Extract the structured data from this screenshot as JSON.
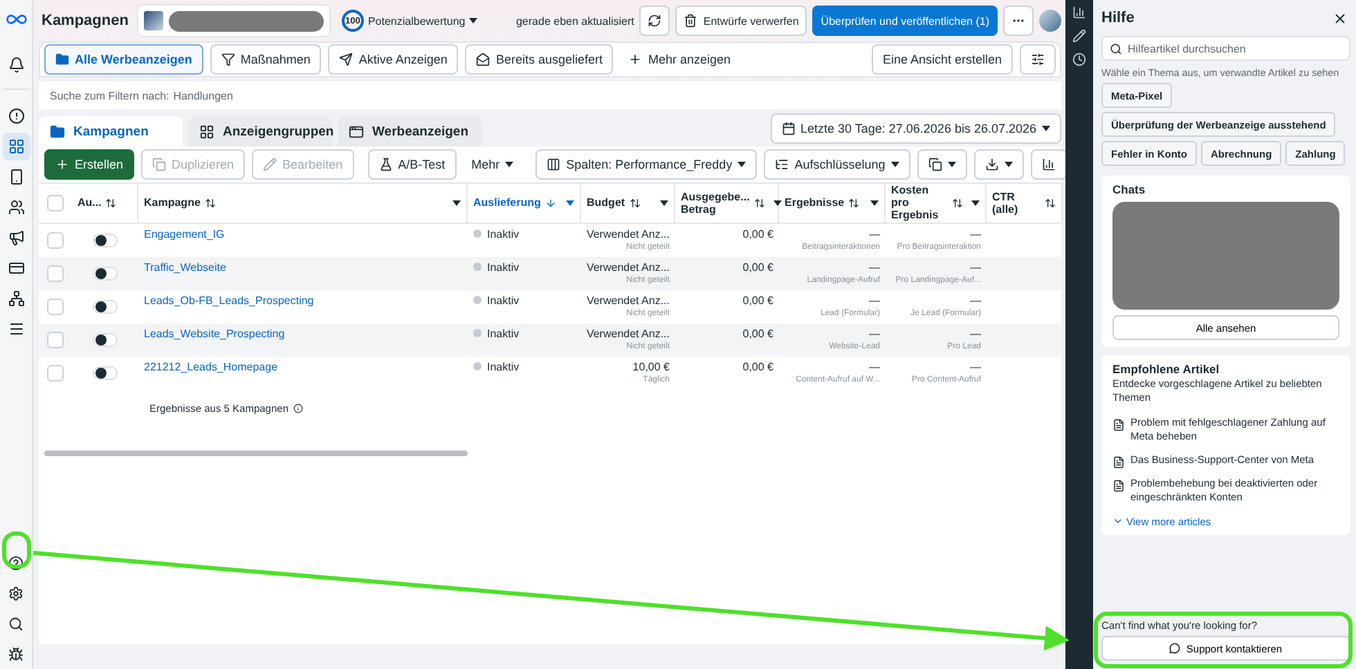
{
  "top_bar": {
    "title": "Kampagnen",
    "score": "100",
    "score_label": "Potenzialbewertung",
    "status": "gerade eben aktualisiert",
    "discard": "Entwürfe verwerfen",
    "publish": "Überprüfen und veröffentlichen (1)"
  },
  "views": [
    {
      "label": "Alle Werbeanzeigen",
      "selected": true
    },
    {
      "label": "Maßnahmen",
      "selected": false
    },
    {
      "label": "Aktive Anzeigen",
      "selected": false
    },
    {
      "label": "Bereits ausgeliefert",
      "selected": false
    }
  ],
  "more_views": "Mehr anzeigen",
  "create_view": "Eine Ansicht erstellen",
  "filter": {
    "label": "Suche zum Filtern nach:",
    "placeholder": "Handlungen"
  },
  "level_tabs": [
    {
      "label": "Kampagnen",
      "selected": true
    },
    {
      "label": "Anzeigengruppen",
      "selected": false
    },
    {
      "label": "Werbeanzeigen",
      "selected": false
    }
  ],
  "date_range": "Letzte 30 Tage: 27.06.2026 bis 26.07.2026",
  "toolbar": {
    "create": "Erstellen",
    "actions": [
      {
        "label": "Duplizieren",
        "disabled": true
      },
      {
        "label": "Bearbeiten",
        "disabled": true
      }
    ],
    "ab_test": "A/B-Test",
    "more": "Mehr",
    "columns": "Spalten: Performance_Freddy",
    "breakdown": "Aufschlüsselung"
  },
  "table": {
    "select_all_checked": false,
    "columns": [
      {
        "label": "Au...",
        "sorted": false,
        "menu": false
      },
      {
        "label": "Kampagne",
        "sorted": false,
        "menu": true
      },
      {
        "label": "Auslieferung",
        "sorted": true,
        "menu": true
      },
      {
        "label": "Budget",
        "sorted": false,
        "menu": true
      },
      {
        "label": "Ausgegebe...\nBetrag",
        "sorted": false,
        "menu": true
      },
      {
        "label": "Ergebnisse",
        "sorted": false,
        "menu": true
      },
      {
        "label": "Kosten pro\nErgebnis",
        "sorted": false,
        "menu": true
      },
      {
        "label": "CTR (alle)",
        "sorted": false,
        "menu": false
      }
    ],
    "rows": [
      {
        "checked": false,
        "on": false,
        "name": "Engagement_IG",
        "delivery": "Inaktiv",
        "budget": "Verwendet Anz...",
        "budget_note": "Nicht geteilt",
        "spent": "0,00 €",
        "results": "—",
        "results_note": "Beitragsinteraktionen",
        "cost": "—",
        "cost_note": "Pro Beitragsinteraktion"
      },
      {
        "checked": false,
        "on": false,
        "name": "Traffic_Webseite",
        "delivery": "Inaktiv",
        "budget": "Verwendet Anz...",
        "budget_note": "Nicht geteilt",
        "spent": "0,00 €",
        "results": "—",
        "results_note": "Landingpage-Aufruf",
        "cost": "—",
        "cost_note": "Pro Landingpage-Auf..."
      },
      {
        "checked": false,
        "on": false,
        "name": "Leads_Ob-FB_Leads_Prospecting",
        "delivery": "Inaktiv",
        "budget": "Verwendet Anz...",
        "budget_note": "Nicht geteilt",
        "spent": "0,00 €",
        "results": "—",
        "results_note": "Lead (Formular)",
        "cost": "—",
        "cost_note": "Je Lead (Formular)"
      },
      {
        "checked": false,
        "on": false,
        "name": "Leads_Website_Prospecting",
        "delivery": "Inaktiv",
        "budget": "Verwendet Anz...",
        "budget_note": "Nicht geteilt",
        "spent": "0,00 €",
        "results": "—",
        "results_note": "Website-Lead",
        "cost": "—",
        "cost_note": "Pro Lead"
      },
      {
        "checked": false,
        "on": false,
        "name": "221212_Leads_Homepage",
        "delivery": "Inaktiv",
        "budget": "10,00 €",
        "budget_note": "Täglich",
        "spent": "0,00 €",
        "results": "—",
        "results_note": "Content-Aufruf auf W...",
        "cost": "—",
        "cost_note": "Pro Content-Aufruf"
      }
    ],
    "summary": "Ergebnisse aus 5 Kampagnen"
  },
  "help": {
    "title": "Hilfe",
    "search_placeholder": "Hilfeartikel durchsuchen",
    "hint": "Wähle ein Thema aus, um verwandte Artikel zu sehen",
    "topics": [
      "Meta-Pixel",
      "Überprüfung der Werbeanzeige ausstehend",
      "Fehler in Konto",
      "Abrechnung",
      "Zahlung"
    ],
    "chats_title": "Chats",
    "see_all": "Alle ansehen",
    "recommended": {
      "title": "Empfohlene Artikel",
      "description": "Entdecke vorgeschlagene Artikel zu beliebten Themen",
      "articles": [
        "Problem mit fehlgeschlagener Zahlung auf Meta beheben",
        "Das Business-Support-Center von Meta",
        "Problembehebung bei deaktivierten oder eingeschränkten Konten"
      ],
      "more": "View more articles"
    },
    "question": "Can't find what you're looking for?",
    "contact": "Support kontaktieren"
  }
}
